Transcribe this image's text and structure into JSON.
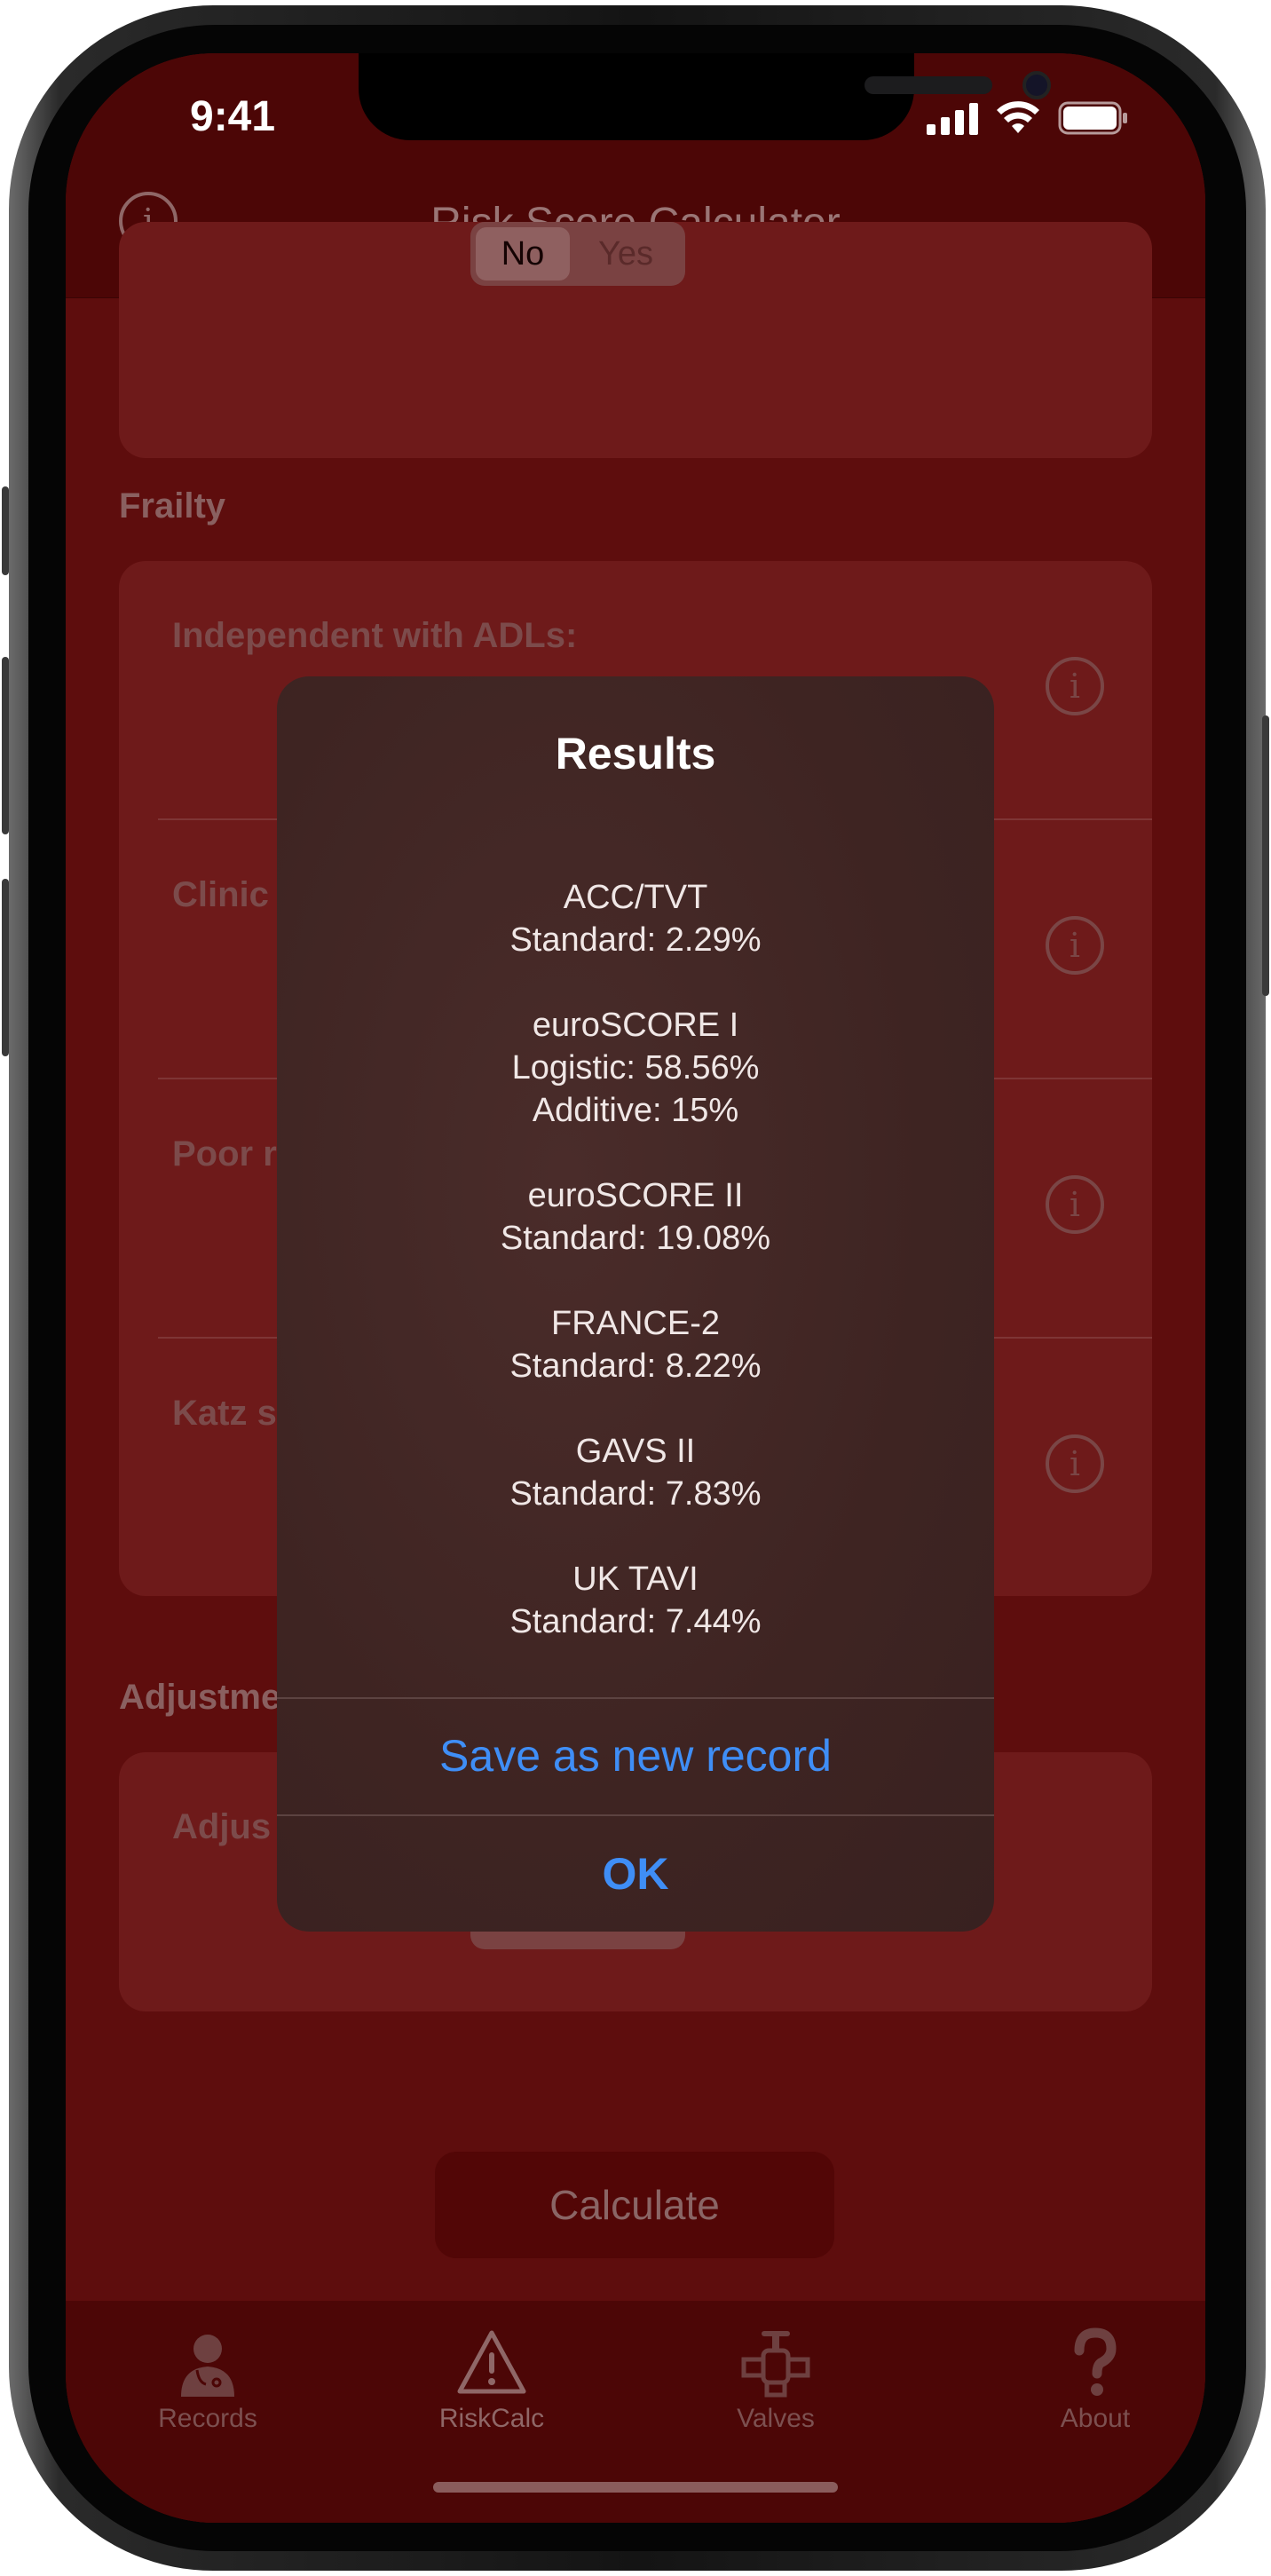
{
  "status_bar": {
    "time": "9:41"
  },
  "nav": {
    "title": "Risk Score Calculator",
    "info_icon": "info-circle-icon"
  },
  "segmented_top": {
    "selected": "No",
    "other": "Yes"
  },
  "sections": {
    "frailty": {
      "header": "Frailty",
      "rows": [
        "Independent with ADLs:",
        "Clinic",
        "Poor r",
        "Katz s"
      ]
    },
    "adjustments": {
      "header": "Adjustme",
      "rows": [
        "Adjus"
      ]
    }
  },
  "calculate_label": "Calculate",
  "tabs": [
    {
      "label": "Records",
      "icon": "doctor-icon"
    },
    {
      "label": "RiskCalc",
      "icon": "warning-triangle-icon"
    },
    {
      "label": "Valves",
      "icon": "valve-icon"
    },
    {
      "label": "About",
      "icon": "question-mark-icon"
    }
  ],
  "alert": {
    "title": "Results",
    "lines": [
      "ACC/TVT",
      "Standard: 2.29%",
      "euroSCORE I",
      "Logistic: 58.56%",
      "Additive: 15%",
      "euroSCORE II",
      "Standard: 19.08%",
      "FRANCE-2",
      "Standard: 8.22%",
      "GAVS II",
      "Standard: 7.83%",
      "UK TAVI",
      "Standard: 7.44%"
    ],
    "save_label": "Save as new record",
    "ok_label": "OK"
  },
  "colors": {
    "background": "#5e0d0d",
    "bar": "#4c0606",
    "accent": "#3f8ef6"
  }
}
